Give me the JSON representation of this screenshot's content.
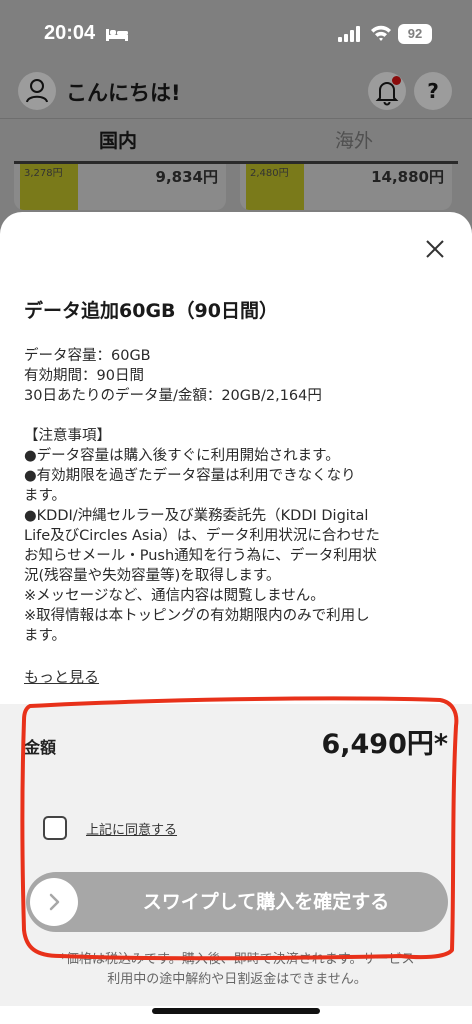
{
  "status_bar": {
    "time": "20:04",
    "battery": "92"
  },
  "header": {
    "greeting": "こんにちは!",
    "help": "?"
  },
  "tabs": [
    {
      "label": "国内"
    },
    {
      "label": "海外"
    }
  ],
  "cards": [
    {
      "tag": "3,278円",
      "price": "9,834円"
    },
    {
      "tag": "2,480円",
      "price": "14,880円"
    }
  ],
  "sheet": {
    "title": "データ追加60GB（90日間）",
    "details": [
      "データ容量：60GB",
      "有効期間：90日間",
      "30日あたりのデータ量/金額：20GB/2,164円"
    ],
    "notes": [
      "【注意事項】",
      "●データ容量は購入後すぐに利用開始されます。",
      "●有効期限を過ぎたデータ容量は利用できなくなり",
      "ます。",
      "●KDDI/沖縄セルラー及び業務委託先（KDDI Digital",
      "Life及びCircles Asia）は、データ利用状況に合わせた",
      "お知らせメール・Push通知を行う為に、データ利用状",
      "況(残容量や失効容量等)を取得します。",
      "※メッセージなど、通信内容は閲覧しません。",
      "※取得情報は本トッピングの有効期限内のみで利用し",
      "ます。"
    ],
    "more_link": "もっと見る",
    "price_label": "金額",
    "price_value": "6,490円*",
    "agree_label": "上記に同意する",
    "swipe_label": "スワイプして購入を確定する",
    "footnote_line1": "*価格は税込みです。購入後、即時で決済されます。サービス",
    "footnote_line2": "利用中の途中解約や日割返金はできません。"
  },
  "colors": {
    "annotation": "#e8311a",
    "swipe_track": "#a7a7a7",
    "price_bg": "#f1f1f1"
  }
}
